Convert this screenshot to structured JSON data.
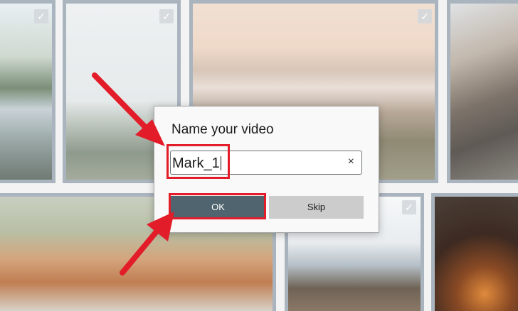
{
  "dialog": {
    "title": "Name your video",
    "input_value": "Mark_1",
    "clear_glyph": "×",
    "ok_label": "OK",
    "skip_label": "Skip"
  },
  "gallery": {
    "check_glyph": "✓",
    "tiles": [
      {
        "id": "tile-1",
        "checked": true
      },
      {
        "id": "tile-2",
        "checked": true
      },
      {
        "id": "tile-3",
        "checked": true
      },
      {
        "id": "tile-4",
        "checked": false
      },
      {
        "id": "tile-5",
        "checked": false
      },
      {
        "id": "tile-6",
        "checked": true
      },
      {
        "id": "tile-7",
        "checked": false
      }
    ]
  },
  "annotations": {
    "color": "#e21d29",
    "icons": [
      "arrow-to-input-icon",
      "arrow-to-ok-icon"
    ]
  },
  "colors": {
    "ok_button": "#4f646e",
    "skip_button": "#cccccc",
    "tile_border": "#aab4bf"
  }
}
